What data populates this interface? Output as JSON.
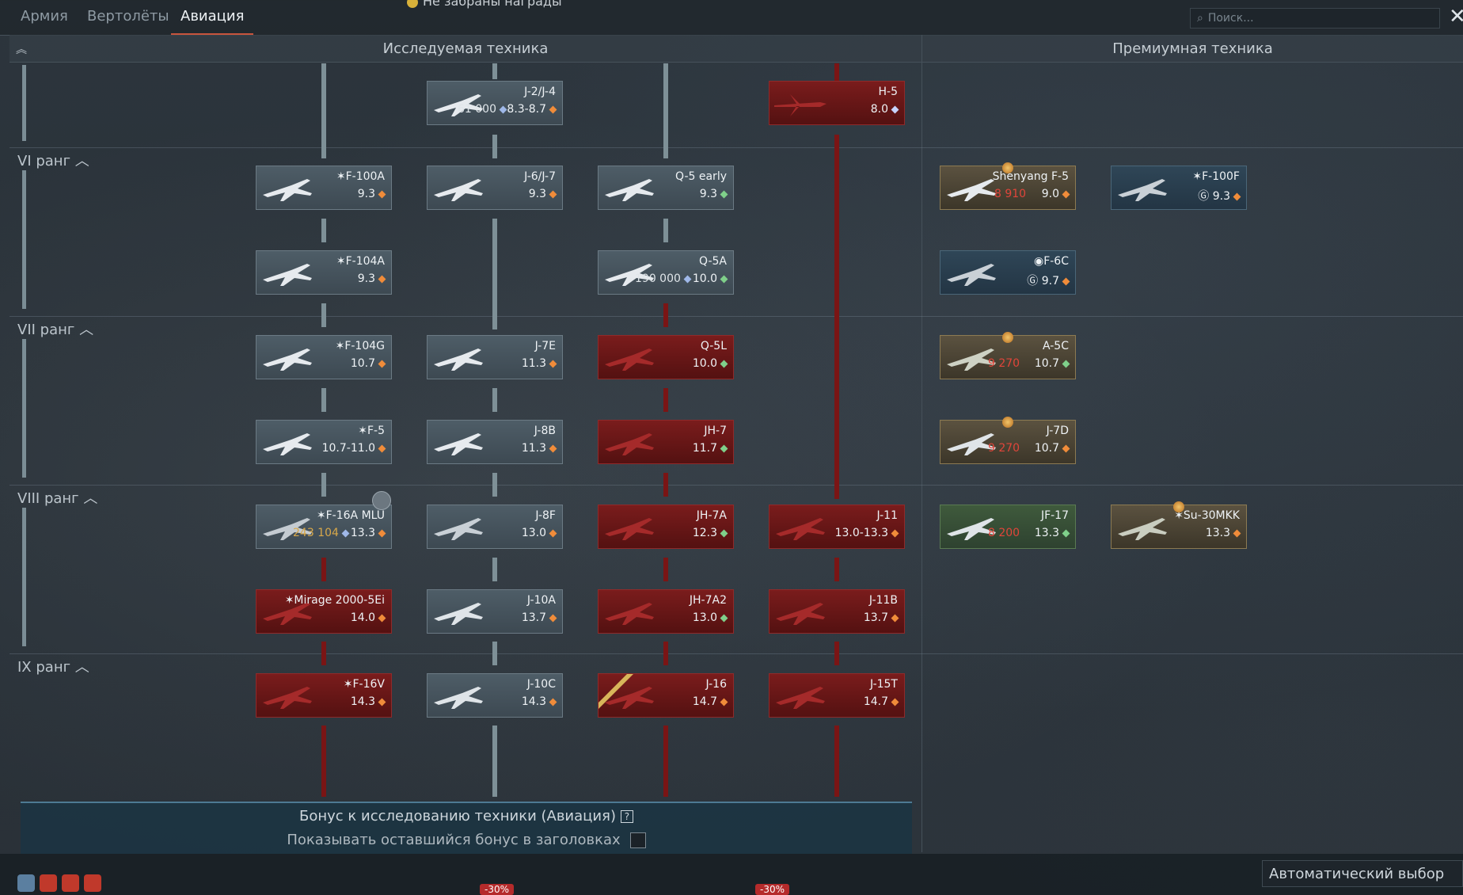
{
  "tabs": [
    {
      "label": "Армия",
      "active": false
    },
    {
      "label": "Вертолёты",
      "active": false
    },
    {
      "label": "Авиация",
      "active": true
    }
  ],
  "notice": "Не забраны награды",
  "search": {
    "placeholder": "Поиск..."
  },
  "headers": {
    "research": "Исследуемая техника",
    "premium": "Премиумная техника"
  },
  "ranks": [
    {
      "label": "VI ранг"
    },
    {
      "label": "VII ранг"
    },
    {
      "label": "VIII ранг"
    },
    {
      "label": "IX ранг"
    }
  ],
  "vehicles": {
    "j2": {
      "name": "J-2/J-4",
      "br": "8.3-8.7",
      "cost": "61 000"
    },
    "h5": {
      "name": "H-5",
      "br": "8.0"
    },
    "f100a": {
      "name": "F-100A",
      "br": "9.3"
    },
    "j6": {
      "name": "J-6/J-7",
      "br": "9.3"
    },
    "q5early": {
      "name": "Q-5 early",
      "br": "9.3"
    },
    "shenyang": {
      "name": "Shenyang F-5",
      "br": "9.0",
      "cost": "8 910"
    },
    "f100f": {
      "name": "F-100F",
      "br": "9.3"
    },
    "f104a": {
      "name": "F-104A",
      "br": "9.3"
    },
    "q5a": {
      "name": "Q-5A",
      "br": "10.0",
      "cost": "190 000"
    },
    "f6c": {
      "name": "F-6C",
      "br": "9.7"
    },
    "f104g": {
      "name": "F-104G",
      "br": "10.7"
    },
    "j7e": {
      "name": "J-7E",
      "br": "11.3"
    },
    "q5l": {
      "name": "Q-5L",
      "br": "10.0"
    },
    "a5c": {
      "name": "A-5C",
      "br": "10.7",
      "cost": "9 270"
    },
    "f5": {
      "name": "F-5",
      "br": "10.7-11.0"
    },
    "j8b": {
      "name": "J-8B",
      "br": "11.3"
    },
    "jh7": {
      "name": "JH-7",
      "br": "11.7"
    },
    "j7d": {
      "name": "J-7D",
      "br": "10.7",
      "cost": "9 270"
    },
    "f16amlu": {
      "name": "F-16A MLU",
      "br": "13.3",
      "cost": "243 104"
    },
    "j8f": {
      "name": "J-8F",
      "br": "13.0"
    },
    "jh7a": {
      "name": "JH-7A",
      "br": "12.3"
    },
    "j11": {
      "name": "J-11",
      "br": "13.0-13.3"
    },
    "jf17": {
      "name": "JF-17",
      "br": "13.3",
      "cost": "8 200"
    },
    "su30": {
      "name": "Su-30MKK",
      "br": "13.3"
    },
    "mirage": {
      "name": "Mirage 2000-5Ei",
      "br": "14.0"
    },
    "j10a": {
      "name": "J-10A",
      "br": "13.7"
    },
    "jh7a2": {
      "name": "JH-7A2",
      "br": "13.0"
    },
    "j11b": {
      "name": "J-11B",
      "br": "13.7"
    },
    "f16v": {
      "name": "F-16V",
      "br": "14.3"
    },
    "j10c": {
      "name": "J-10C",
      "br": "14.3"
    },
    "j16": {
      "name": "J-16",
      "br": "14.7"
    },
    "j15t": {
      "name": "J-15T",
      "br": "14.7"
    }
  },
  "bonus": {
    "title": "Бонус к исследованию техники (Авиация)",
    "show_remaining": "Показывать оставшийся бонус в заголовках"
  },
  "bottom": {
    "auto_select": "Автоматический выбор",
    "discount1": "-30%",
    "discount2": "-30%"
  },
  "colors": {
    "accent": "#c8553d",
    "locked": "#7a1c1c",
    "line": "#7e9097"
  }
}
